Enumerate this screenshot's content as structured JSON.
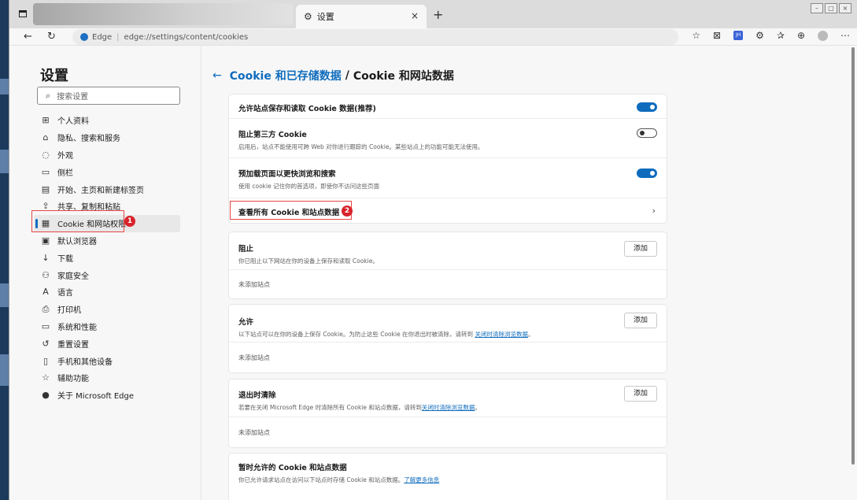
{
  "tab": {
    "title": "设置",
    "close": "×",
    "new": "+"
  },
  "address": {
    "browser": "Edge",
    "separator": "|",
    "url": "edge://settings/content/cookies"
  },
  "sidebar": {
    "title": "设置",
    "search_placeholder": "搜索设置",
    "items": [
      {
        "icon": "profile-icon",
        "glyph": "⊞",
        "label": "个人资料"
      },
      {
        "icon": "lock-icon",
        "glyph": "⌂",
        "label": "隐私、搜索和服务"
      },
      {
        "icon": "appearance-icon",
        "glyph": "◌",
        "label": "外观"
      },
      {
        "icon": "sidebar-icon",
        "glyph": "▭",
        "label": "侧栏"
      },
      {
        "icon": "home-icon",
        "glyph": "▤",
        "label": "开始、主页和新建标签页"
      },
      {
        "icon": "share-icon",
        "glyph": "⇪",
        "label": "共享、复制和粘贴"
      },
      {
        "icon": "cookie-icon",
        "glyph": "▦",
        "label": "Cookie 和网站权限"
      },
      {
        "icon": "browser-icon",
        "glyph": "▣",
        "label": "默认浏览器"
      },
      {
        "icon": "download-icon",
        "glyph": "↓",
        "label": "下载"
      },
      {
        "icon": "family-icon",
        "glyph": "⚇",
        "label": "家庭安全"
      },
      {
        "icon": "language-icon",
        "glyph": "A",
        "label": "语言"
      },
      {
        "icon": "printer-icon",
        "glyph": "⎙",
        "label": "打印机"
      },
      {
        "icon": "system-icon",
        "glyph": "▭",
        "label": "系统和性能"
      },
      {
        "icon": "reset-icon",
        "glyph": "↺",
        "label": "重置设置"
      },
      {
        "icon": "phone-icon",
        "glyph": "▯",
        "label": "手机和其他设备"
      },
      {
        "icon": "accessibility-icon",
        "glyph": "☆",
        "label": "辅助功能"
      },
      {
        "icon": "edge-icon",
        "glyph": "●",
        "label": "关于 Microsoft Edge"
      }
    ]
  },
  "annotations": {
    "one": "1",
    "two": "2"
  },
  "main": {
    "breadcrumb_parent": "Cookie 和已存储数据",
    "separator": "/",
    "breadcrumb_current": "Cookie 和网站数据",
    "settings": {
      "allow": {
        "title": "允许站点保存和读取 Cookie 数据(推荐)",
        "enabled": true
      },
      "block_third": {
        "title": "阻止第三方 Cookie",
        "desc": "启用后，站点不能使用可跨 Web 对你进行跟踪的 Cookie。某些站点上的功能可能无法使用。",
        "enabled": false
      },
      "preload": {
        "title": "预加载页面以更快浏览和搜索",
        "desc": "使用 cookie 记住你的首选项，即使你不访问这些页面",
        "enabled": true
      },
      "see_all": {
        "title": "查看所有 Cookie 和站点数据"
      }
    },
    "block": {
      "title": "阻止",
      "desc": "你已阻止以下网站在你的设备上保存和读取 Cookie。",
      "add": "添加",
      "empty": "未添加站点"
    },
    "allow_list": {
      "title": "允许",
      "desc": "以下站点可以在你的设备上保存 Cookie。为防止这些 Cookie 在你退出时被清除，请转到 ",
      "link": "关闭时清除浏览数据",
      "end": "。",
      "add": "添加",
      "empty": "未添加站点"
    },
    "clear_on_exit": {
      "title": "退出时清除",
      "desc": "若要在关闭 Microsoft Edge 时清除所有 Cookie 和站点数据，请转到",
      "link": "关闭时清除浏览数据",
      "end": "。",
      "add": "添加",
      "empty": "未添加站点"
    },
    "temp": {
      "title": "暂时允许的 Cookie 和站点数据",
      "desc": "你已允许请求站点在访问以下站点时存储 Cookie 和站点数据。",
      "link": "了解更多信息"
    }
  }
}
